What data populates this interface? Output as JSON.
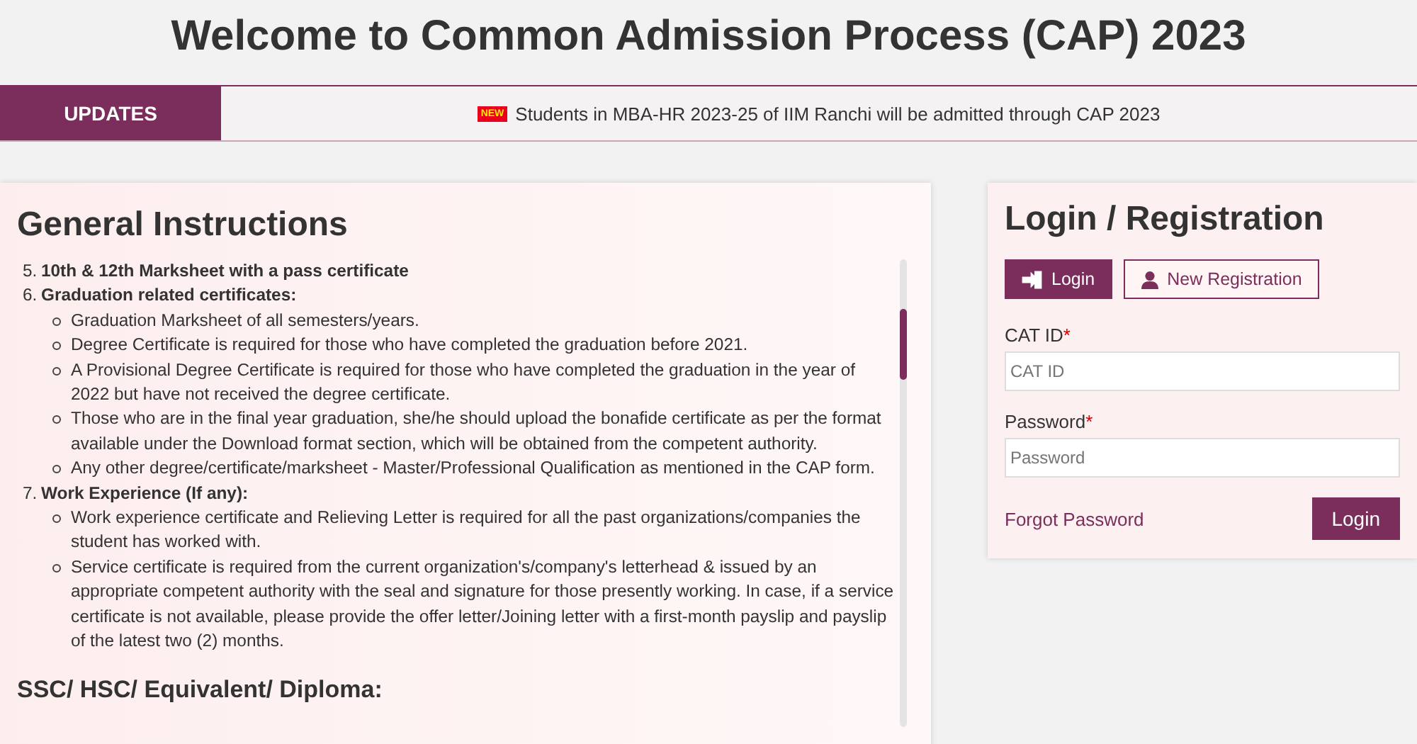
{
  "page_title": "Welcome to Common Admission Process (CAP) 2023",
  "updates": {
    "label": "UPDATES",
    "badge": "NEW",
    "message": "Students in MBA-HR 2023-25 of IIM Ranchi will be admitted through CAP 2023"
  },
  "instructions": {
    "title": "General Instructions",
    "items": [
      {
        "number": "5.",
        "text": "10th & 12th Marksheet with a pass certificate"
      },
      {
        "number": "6.",
        "text": "Graduation related certificates:",
        "children": [
          "Graduation Marksheet of all semesters/years.",
          "Degree Certificate is required for those who have completed the graduation before 2021.",
          "A Provisional Degree Certificate is required for those who have completed the graduation in the year of 2022 but have not received the degree certificate.",
          "Those who are in the final year graduation, she/he should upload the bonafide certificate as per the format available under the Download format section, which will be obtained from the competent authority.",
          "Any other degree/certificate/marksheet - Master/Professional Qualification as mentioned in the CAP form."
        ]
      },
      {
        "number": "7.",
        "text": "Work Experience (If any):",
        "children": [
          "Work experience certificate and Relieving Letter is required for all the past organizations/companies the student has worked with.",
          "Service certificate is required from the current organization's/company's letterhead & issued by an appropriate competent authority with the seal and signature for those presently working. In case, if a service certificate is not available, please provide the offer letter/Joining letter with a first-month payslip and payslip of the latest two (2) months."
        ]
      }
    ],
    "subheading": "SSC/ HSC/ Equivalent/ Diploma:"
  },
  "login": {
    "title": "Login / Registration",
    "tabs": [
      {
        "label": "Login",
        "selected": true
      },
      {
        "label": "New Registration",
        "selected": false
      }
    ],
    "fields": [
      {
        "label": "CAT ID",
        "required_mark": "*",
        "placeholder": "CAT ID"
      },
      {
        "label": "Password",
        "required_mark": "*",
        "placeholder": "Password"
      }
    ],
    "forgot": "Forgot Password",
    "submit": "Login"
  }
}
